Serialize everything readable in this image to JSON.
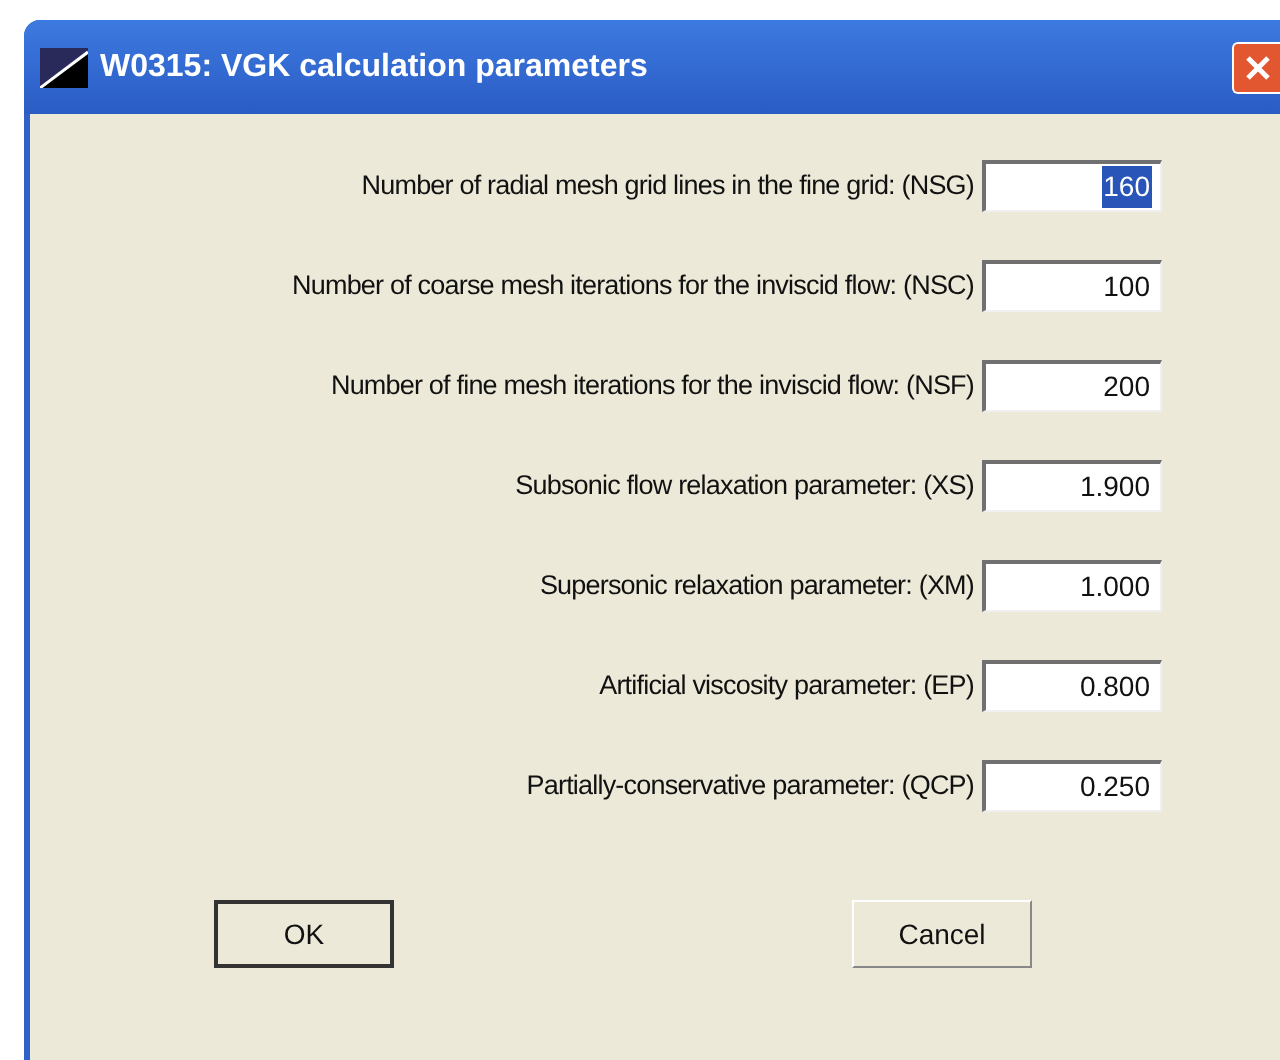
{
  "window": {
    "title": "W0315: VGK calculation parameters"
  },
  "parameters": [
    {
      "label": "Number of radial mesh grid lines in the fine grid: (NSG)",
      "value": "160",
      "highlighted": true
    },
    {
      "label": "Number of coarse mesh iterations for the inviscid flow: (NSC)",
      "value": "100",
      "highlighted": false
    },
    {
      "label": "Number of fine mesh iterations for the inviscid flow: (NSF)",
      "value": "200",
      "highlighted": false
    },
    {
      "label": "Subsonic flow relaxation parameter: (XS)",
      "value": "1.900",
      "highlighted": false
    },
    {
      "label": "Supersonic relaxation parameter: (XM)",
      "value": "1.000",
      "highlighted": false
    },
    {
      "label": "Artificial viscosity parameter: (EP)",
      "value": "0.800",
      "highlighted": false
    },
    {
      "label": "Partially-conservative parameter: (QCP)",
      "value": "0.250",
      "highlighted": false
    }
  ],
  "buttons": [
    {
      "label": "OK",
      "default": true
    },
    {
      "label": "Cancel",
      "default": false
    }
  ]
}
